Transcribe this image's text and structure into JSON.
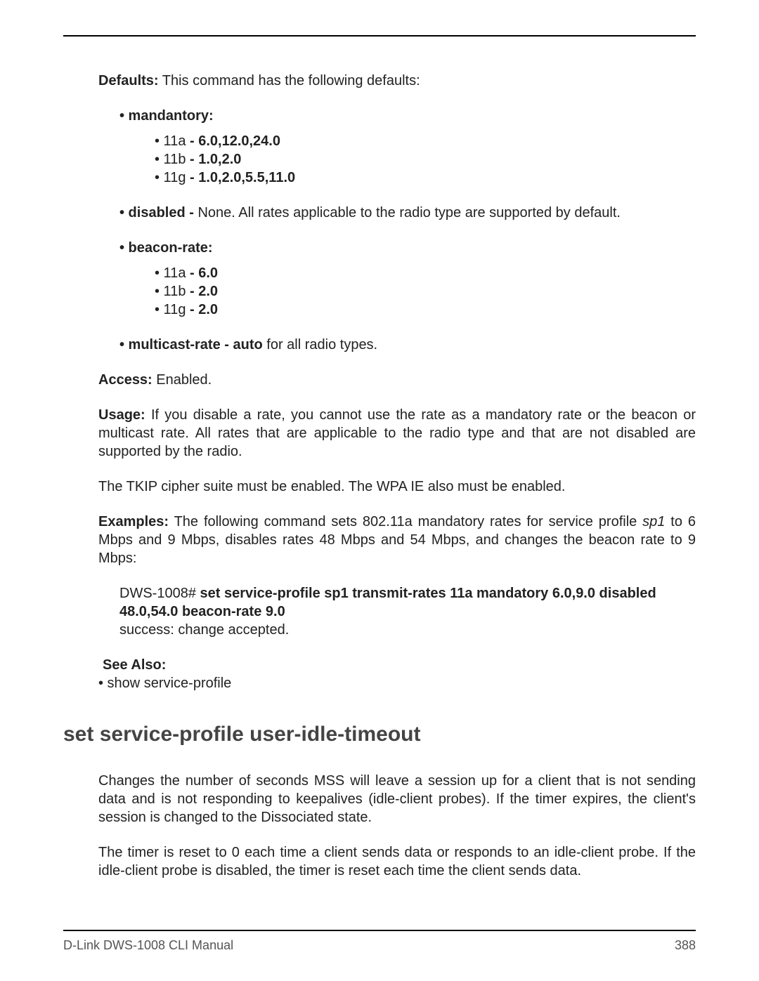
{
  "defaults": {
    "label": "Defaults:",
    "text": "  This command has the following defaults:"
  },
  "mandatory_label": "• mandantory:",
  "mandatory": {
    "a_pre": "• 11a ",
    "a_val": "- 6.0,12.0,24.0",
    "b_pre": "• 11b ",
    "b_val": "- 1.0,2.0",
    "g_pre": "• 11g ",
    "g_val": "- 1.0,2.0,5.5,11.0"
  },
  "disabled": {
    "label": "• disabled - ",
    "text": "None. All rates applicable to the radio type are supported by default."
  },
  "beacon_label": "• beacon-rate:",
  "beacon": {
    "a_pre": "• 11a ",
    "a_val": "- 6.0",
    "b_pre": "• 11b ",
    "b_val": "- 2.0",
    "g_pre": "• 11g ",
    "g_val": "- 2.0"
  },
  "multicast": {
    "label": "• multicast-rate - auto ",
    "text": "for all radio types."
  },
  "access": {
    "label": "Access:",
    "text": "  Enabled."
  },
  "usage": {
    "label": "Usage:",
    "text": "  If you disable a rate, you cannot use the rate as a mandatory rate or the beacon or multicast rate. All rates that are applicable to the radio type and that are not disabled are supported by the radio."
  },
  "tkip": "The TKIP cipher suite must be enabled. The WPA IE also must be enabled.",
  "examples": {
    "label": "Examples:",
    "text_pre": "  The following command sets 802.11a mandatory rates for service profile ",
    "profile": "sp1",
    "text_post": " to 6 Mbps and 9 Mbps, disables rates 48 Mbps and 54 Mbps, and changes the beacon rate to 9 Mbps:"
  },
  "cmd": {
    "prompt": "DWS-1008# ",
    "line1": "set service-profile sp1 transmit-rates 11a mandatory 6.0,9.0 disabled",
    "line2": "48.0,54.0 beacon-rate 9.0",
    "result": "success: change accepted."
  },
  "seealso": {
    "label": "See Also:",
    "item": "• show service-profile"
  },
  "section_title": "set service-profile user-idle-timeout",
  "section_p1": "Changes the number of seconds MSS will leave a session up for a client that is not sending data and is not responding to keepalives (idle-client probes). If the timer expires, the client's session is changed to the Dissociated state.",
  "section_p2": "The timer is reset to 0 each time a client sends data or responds to an idle-client probe. If the idle-client probe is disabled, the timer is reset each time the client sends data.",
  "footer": {
    "left": "D-Link DWS-1008 CLI Manual",
    "right": "388"
  }
}
